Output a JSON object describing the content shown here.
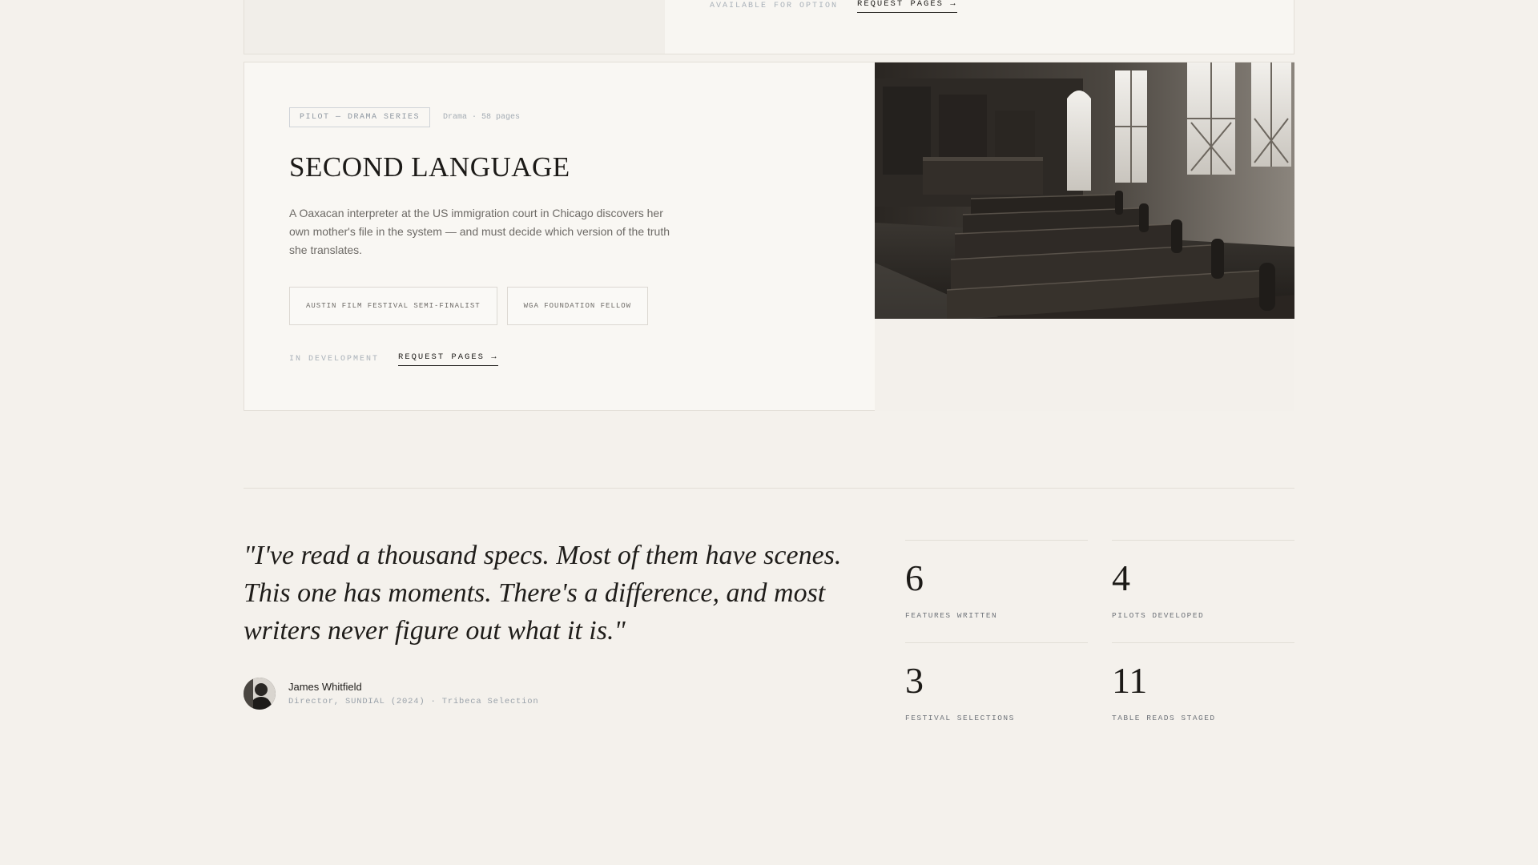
{
  "top_project": {
    "status": "AVAILABLE FOR OPTION",
    "request_label": "REQUEST PAGES →"
  },
  "project": {
    "tag": "PILOT — DRAMA SERIES",
    "meta": "Drama · 58 pages",
    "title": "SECOND LANGUAGE",
    "logline": "A Oaxacan interpreter at the US immigration court in Chicago discovers her own mother's file in the system — and must decide which version of the truth she translates.",
    "awards": [
      "AUSTIN FILM FESTIVAL SEMI-FINALIST",
      "WGA FOUNDATION FELLOW"
    ],
    "status": "IN DEVELOPMENT",
    "request_label": "REQUEST PAGES →",
    "image_icon": "courtroom-photo"
  },
  "testimonial": {
    "quote": "\"I've read a thousand specs. Most of them have scenes. This one has moments. There's a difference, and most writers never figure out what it is.\"",
    "name": "James Whitfield",
    "role": "Director, SUNDIAL (2024) · Tribeca Selection"
  },
  "stats": [
    {
      "value": "6",
      "label": "FEATURES WRITTEN"
    },
    {
      "value": "4",
      "label": "PILOTS DEVELOPED"
    },
    {
      "value": "3",
      "label": "FESTIVAL SELECTIONS"
    },
    {
      "value": "11",
      "label": "TABLE READS STAGED"
    }
  ],
  "colors": {
    "background": "#f4f1ec",
    "card": "#f9f7f3",
    "ink": "#1f1d1a",
    "muted": "#a9b1b9"
  }
}
